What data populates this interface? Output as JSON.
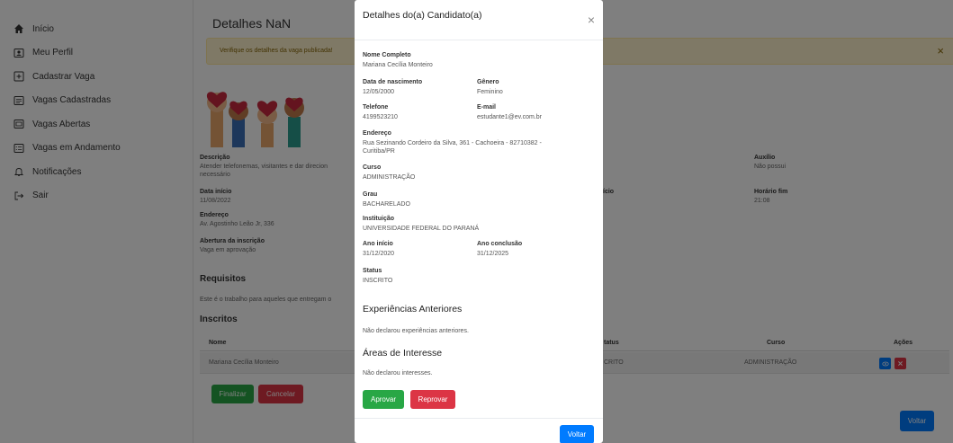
{
  "sidebar": {
    "items": [
      {
        "label": "Início",
        "icon": "home-icon"
      },
      {
        "label": "Meu Perfil",
        "icon": "profile-icon"
      },
      {
        "label": "Cadastrar Vaga",
        "icon": "plus-square-icon"
      },
      {
        "label": "Vagas Cadastradas",
        "icon": "list-icon"
      },
      {
        "label": "Vagas Abertas",
        "icon": "list-alt-icon"
      },
      {
        "label": "Vagas em Andamento",
        "icon": "tasks-icon"
      },
      {
        "label": "Notificações",
        "icon": "bell-icon"
      },
      {
        "label": "Sair",
        "icon": "logout-icon"
      }
    ]
  },
  "main": {
    "title": "Detalhes NaN",
    "alert": "Verifique os detalhes da vaga publicada!",
    "alert_close": "×",
    "descricao_label": "Descrição",
    "descricao_value": "Atender telefonemas, visitantes e dar direcion",
    "descricao_value2": "necessário",
    "auxilio_label": "Auxílio",
    "auxilio_value": "Não possui",
    "data_inicio_label": "Data início",
    "data_inicio_value": "11/08/2022",
    "horario_inicio_label": "ício",
    "horario_fim_label": "Horário fim",
    "horario_fim_value": "21:08",
    "endereco_label": "Endereço",
    "endereco_value": "Av. Agostinho Leão Jr, 336",
    "abertura_label": "Abertura da inscrição",
    "abertura_value": "Vaga em aprovação",
    "requisitos_title": "Requisitos",
    "requisitos_text": "Este é o trabalho para aqueles que entregam o",
    "inscritos_title": "Inscritos",
    "table_headers": [
      "Nome",
      "tatus",
      "Curso",
      "Ações"
    ],
    "table_rows": [
      [
        "Mariana Cecília Monteiro",
        "CRITO",
        "ADMINISTRAÇÃO"
      ]
    ],
    "finalizar": "Finalizar",
    "cancelar": "Cancelar",
    "voltar": "Voltar"
  },
  "modal": {
    "title": "Detalhes do(a) Candidato(a)",
    "close": "×",
    "nome_label": "Nome Completo",
    "nome_value": "Mariana Cecília Monteiro",
    "nascimento_label": "Data de nascimento",
    "nascimento_value": "12/05/2000",
    "genero_label": "Gênero",
    "genero_value": "Feminino",
    "telefone_label": "Telefone",
    "telefone_value": "4199523210",
    "email_label": "E-mail",
    "email_value": "estudante1@ev.com.br",
    "endereco_label": "Endereço",
    "endereco_value": "Rua Sezinando Cordeiro da Silva, 361 - Cachoeira - 82710382 - Curitiba/PR",
    "curso_label": "Curso",
    "curso_value": "ADMINISTRAÇÃO",
    "grau_label": "Grau",
    "grau_value": "BACHARELADO",
    "instituicao_label": "Instituição",
    "instituicao_value": "UNIVERSIDADE FEDERAL DO PARANÁ",
    "ano_inicio_label": "Ano início",
    "ano_inicio_value": "31/12/2020",
    "ano_conclusao_label": "Ano conclusão",
    "ano_conclusao_value": "31/12/2025",
    "status_label": "Status",
    "status_value": "INSCRITO",
    "experiencias_title": "Experiências Anteriores",
    "experiencias_text": "Não declarou experiências anteriores.",
    "areas_title": "Áreas de Interesse",
    "areas_text": "Não declarou interesses.",
    "aprovar": "Aprovar",
    "reprovar": "Reprovar",
    "voltar": "Voltar"
  },
  "colors": {
    "success": "#28a745",
    "danger": "#dc3545",
    "primary": "#007bff",
    "alert_bg": "#fff3cd"
  }
}
